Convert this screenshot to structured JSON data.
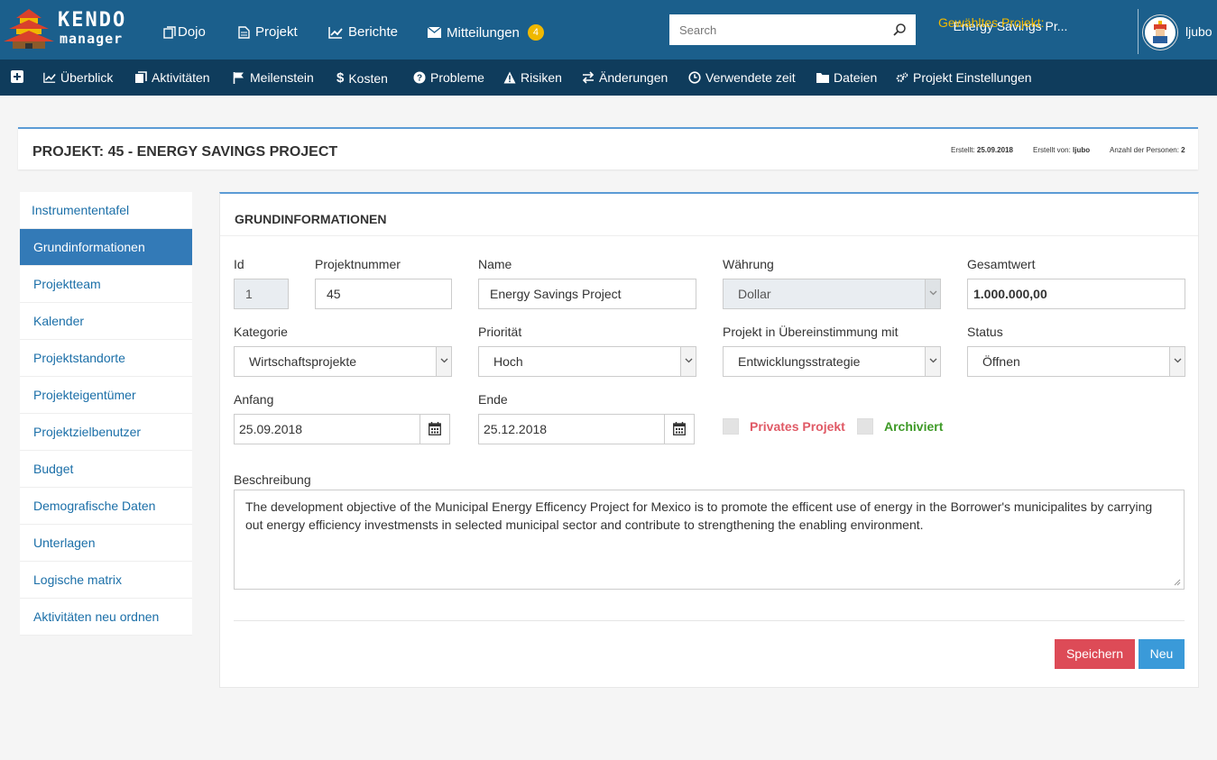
{
  "topbar": {
    "logo_title": "KENDO",
    "logo_sub": "manager",
    "nav": [
      {
        "label": "Dojo",
        "icon": "copy-icon"
      },
      {
        "label": "Projekt",
        "icon": "document-icon"
      },
      {
        "label": "Berichte",
        "icon": "line-chart-icon"
      },
      {
        "label": "Mitteilungen",
        "icon": "envelope-icon",
        "badge": "4"
      }
    ],
    "search_placeholder": "Search",
    "project_label": "Gewähltes Projekt:",
    "project_value": "Energy Savings Pr...",
    "username": "ljubo"
  },
  "subnav": [
    {
      "label": "Überblick",
      "icon": "line-chart-icon"
    },
    {
      "label": "Aktivitäten",
      "icon": "copy-icon"
    },
    {
      "label": "Meilenstein",
      "icon": "flag-icon"
    },
    {
      "label": "Kosten",
      "icon": "dollar-icon"
    },
    {
      "label": "Probleme",
      "icon": "question-circle-icon"
    },
    {
      "label": "Risiken",
      "icon": "warning-icon"
    },
    {
      "label": "Änderungen",
      "icon": "exchange-icon"
    },
    {
      "label": "Verwendete zeit",
      "icon": "clock-icon"
    },
    {
      "label": "Dateien",
      "icon": "folder-icon"
    },
    {
      "label": "Projekt Einstellungen",
      "icon": "gears-icon"
    }
  ],
  "header": {
    "title": "PROJEKT: 45 - ENERGY SAVINGS PROJECT",
    "created_label": "Erstellt:",
    "created_value": "25.09.2018",
    "created_by_label": "Erstellt von:",
    "created_by_value": "ljubo",
    "persons_label": "Anzahl der Personen:",
    "persons_value": "2"
  },
  "sidebar": [
    "Instrumententafel",
    "Grundinformationen",
    "Projektteam",
    "Kalender",
    "Projektstandorte",
    "Projekteigentümer",
    "Projektzielbenutzer",
    "Budget",
    "Demografische Daten",
    "Unterlagen",
    "Logische matrix",
    "Aktivitäten neu ordnen"
  ],
  "form": {
    "title": "GRUNDINFORMATIONEN",
    "id_label": "Id",
    "id_value": "1",
    "number_label": "Projektnummer",
    "number_value": "45",
    "name_label": "Name",
    "name_value": "Energy Savings Project",
    "currency_label": "Währung",
    "currency_value": "Dollar",
    "total_label": "Gesamtwert",
    "total_value": "1.000.000,00",
    "category_label": "Kategorie",
    "category_value": "Wirtschaftsprojekte",
    "priority_label": "Priorität",
    "priority_value": "Hoch",
    "compliance_label": "Projekt in Übereinstimmung mit",
    "compliance_value": "Entwicklungsstrategie",
    "status_label": "Status",
    "status_value": "Öffnen",
    "start_label": "Anfang",
    "start_value": "25.09.2018",
    "end_label": "Ende",
    "end_value": "25.12.2018",
    "private_label": "Privates Projekt",
    "archived_label": "Archiviert",
    "desc_label": "Beschreibung",
    "desc_value": "The development objective of the Municipal Energy Efficency Project for Mexico is to promote the efficent use of energy in the Borrower's municipalites by carrying out energy efficiency investmensts in selected municipal sector and contribute to strengthening the enabling environment.",
    "save_label": "Speichern",
    "new_label": "Neu"
  },
  "colors": {
    "topbar": "#1b5f8c",
    "subnav": "#0f3c5c",
    "accent": "#337ab7",
    "private": "#e05a66",
    "archived": "#3e9a27",
    "save": "#dd4b57",
    "new": "#3a9ad9"
  }
}
